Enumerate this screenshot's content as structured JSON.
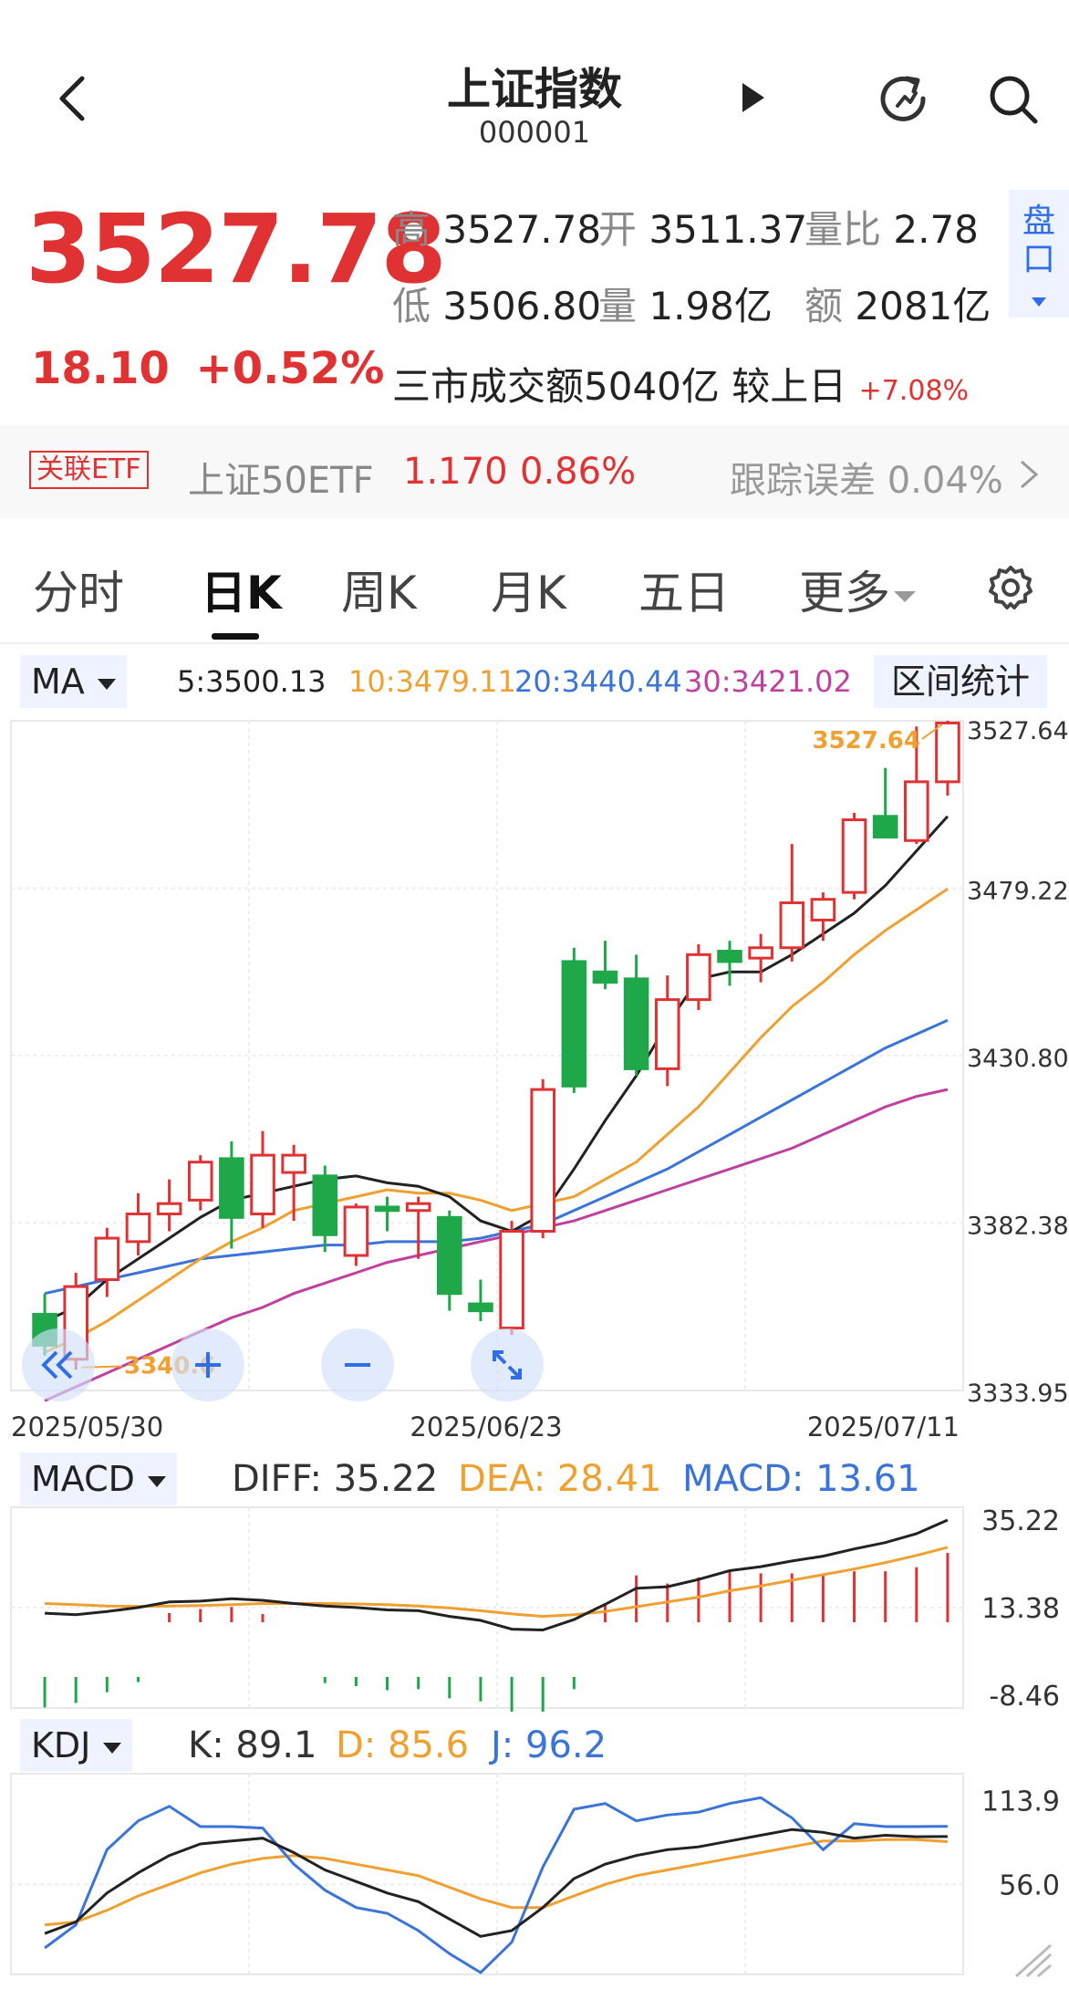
{
  "header": {
    "title": "上证指数",
    "code": "000001"
  },
  "quote": {
    "price": "3527.78",
    "change": "18.10",
    "change_pct": "+0.52%",
    "high_label": "高",
    "high": "3527.78",
    "open_label": "开",
    "open": "3511.37",
    "vol_ratio_label": "量比",
    "vol_ratio": "2.78",
    "low_label": "低",
    "low": "3506.80",
    "volume_label": "量",
    "volume": "1.98亿",
    "amount_label": "额",
    "amount": "2081亿",
    "market_turnover": "三市成交额5040亿 较上日",
    "market_turnover_chg": "+7.08%",
    "pankou_label": "盘口"
  },
  "etf": {
    "tag": "关联ETF",
    "name": "上证50ETF",
    "price": "1.170",
    "pct": "0.86%",
    "tracking": "跟踪误差 0.04%"
  },
  "tabs": [
    "分时",
    "日K",
    "周K",
    "月K",
    "五日",
    "更多"
  ],
  "ma": {
    "selector": "MA",
    "ma5": "5:3500.13",
    "ma10": "10:3479.11",
    "ma20": "20:3440.44",
    "ma30": "30:3421.02",
    "range_stats": "区间统计"
  },
  "colors": {
    "up": "#e03232",
    "down": "#1ea84a",
    "ma5": "#222222",
    "ma10": "#f0a030",
    "ma20": "#3a74d8",
    "ma30": "#c040a0",
    "accent": "#2f6ee8"
  },
  "chart_data": [
    {
      "type": "candlestick",
      "y_ticks": [
        "3527.64",
        "3479.22",
        "3430.80",
        "3382.38",
        "3333.95"
      ],
      "ylim": [
        3333.95,
        3527.64
      ],
      "x_labels": [
        "2025/05/30",
        "2025/06/23",
        "2025/07/11"
      ],
      "max_marker": "3527.64",
      "min_marker": "3340.6",
      "candles": [
        {
          "o": 3356,
          "h": 3362,
          "l": 3344,
          "c": 3347
        },
        {
          "o": 3343,
          "h": 3368,
          "l": 3340,
          "c": 3364
        },
        {
          "o": 3366,
          "h": 3381,
          "l": 3361,
          "c": 3378
        },
        {
          "o": 3377,
          "h": 3391,
          "l": 3373,
          "c": 3385
        },
        {
          "o": 3385,
          "h": 3395,
          "l": 3380,
          "c": 3388
        },
        {
          "o": 3389,
          "h": 3402,
          "l": 3386,
          "c": 3400
        },
        {
          "o": 3401,
          "h": 3406,
          "l": 3375,
          "c": 3384
        },
        {
          "o": 3385,
          "h": 3409,
          "l": 3381,
          "c": 3402
        },
        {
          "o": 3397,
          "h": 3405,
          "l": 3383,
          "c": 3402
        },
        {
          "o": 3396,
          "h": 3399,
          "l": 3374,
          "c": 3379
        },
        {
          "o": 3373,
          "h": 3388,
          "l": 3370,
          "c": 3387
        },
        {
          "o": 3387,
          "h": 3390,
          "l": 3380,
          "c": 3386
        },
        {
          "o": 3386,
          "h": 3390,
          "l": 3372,
          "c": 3388
        },
        {
          "o": 3384,
          "h": 3386,
          "l": 3357,
          "c": 3362
        },
        {
          "o": 3359,
          "h": 3366,
          "l": 3354,
          "c": 3357
        },
        {
          "o": 3352,
          "h": 3383,
          "l": 3350,
          "c": 3380
        },
        {
          "o": 3380,
          "h": 3424,
          "l": 3378,
          "c": 3421
        },
        {
          "o": 3458,
          "h": 3462,
          "l": 3420,
          "c": 3422
        },
        {
          "o": 3455,
          "h": 3464,
          "l": 3450,
          "c": 3452
        },
        {
          "o": 3453,
          "h": 3460,
          "l": 3425,
          "c": 3427
        },
        {
          "o": 3427,
          "h": 3454,
          "l": 3422,
          "c": 3447
        },
        {
          "o": 3447,
          "h": 3463,
          "l": 3444,
          "c": 3460
        },
        {
          "o": 3461,
          "h": 3464,
          "l": 3451,
          "c": 3458
        },
        {
          "o": 3459,
          "h": 3466,
          "l": 3452,
          "c": 3462
        },
        {
          "o": 3462,
          "h": 3492,
          "l": 3458,
          "c": 3475
        },
        {
          "o": 3470,
          "h": 3478,
          "l": 3464,
          "c": 3476
        },
        {
          "o": 3478,
          "h": 3501,
          "l": 3476,
          "c": 3499
        },
        {
          "o": 3500,
          "h": 3514,
          "l": 3495,
          "c": 3494
        },
        {
          "o": 3493,
          "h": 3526,
          "l": 3492,
          "c": 3510
        },
        {
          "o": 3510,
          "h": 3527.64,
          "l": 3506,
          "c": 3527
        }
      ],
      "ma5": [
        3354,
        3358,
        3366,
        3372,
        3378,
        3384,
        3389,
        3391,
        3393,
        3395,
        3396,
        3394,
        3393,
        3390,
        3383,
        3380,
        3385,
        3398,
        3412,
        3425,
        3440,
        3453,
        3455,
        3455,
        3460,
        3466,
        3472,
        3480,
        3490,
        3500
      ],
      "ma10": [
        3345,
        3349,
        3354,
        3360,
        3366,
        3372,
        3377,
        3381,
        3386,
        3388,
        3390,
        3392,
        3391,
        3391,
        3389,
        3386,
        3388,
        3390,
        3395,
        3400,
        3408,
        3416,
        3426,
        3436,
        3445,
        3452,
        3460,
        3467,
        3473,
        3479
      ],
      "ma20": [
        3362,
        3364,
        3366,
        3368,
        3370,
        3372,
        3373,
        3374,
        3375,
        3376,
        3376,
        3377,
        3377,
        3377,
        3378,
        3380,
        3382,
        3386,
        3390,
        3394,
        3398,
        3403,
        3408,
        3413,
        3418,
        3423,
        3428,
        3433,
        3437,
        3441
      ],
      "ma30": [
        3331,
        3335,
        3339,
        3343,
        3347,
        3351,
        3355,
        3358,
        3362,
        3365,
        3368,
        3371,
        3373,
        3375,
        3377,
        3379,
        3381,
        3383,
        3386,
        3389,
        3392,
        3395,
        3398,
        3401,
        3404,
        3408,
        3412,
        3416,
        3419,
        3421
      ]
    },
    {
      "type": "macd",
      "selector": "MACD",
      "diff_label": "DIFF: 35.22",
      "dea_label": "DEA: 28.41",
      "macd_label": "MACD: 13.61",
      "y_ticks": [
        "35.22",
        "13.38",
        "-8.46"
      ],
      "ylim": [
        -8.46,
        35.22
      ],
      "diff": [
        12.0,
        11.6,
        12.4,
        13.4,
        14.8,
        15.0,
        15.6,
        15.2,
        14.4,
        13.8,
        13.4,
        12.8,
        12.6,
        11.2,
        10.2,
        8.0,
        7.8,
        10.4,
        14.2,
        18.2,
        18.6,
        20.4,
        22.6,
        23.6,
        25.0,
        26.2,
        28.0,
        29.6,
        31.8,
        35.22
      ],
      "dea": [
        14.4,
        14.1,
        13.8,
        13.7,
        13.8,
        13.9,
        14.1,
        14.4,
        14.4,
        14.4,
        14.3,
        14.1,
        13.8,
        13.3,
        12.6,
        11.8,
        11.2,
        11.6,
        12.4,
        13.6,
        14.8,
        16.0,
        17.6,
        18.8,
        20.2,
        21.6,
        23.0,
        24.6,
        26.4,
        28.41
      ],
      "macd": [
        -6.0,
        -5.1,
        -3.0,
        -1.0,
        1.8,
        2.6,
        3.0,
        1.6,
        0,
        -1.2,
        -1.8,
        -2.6,
        -2.4,
        -4.2,
        -4.8,
        -7.6,
        -6.8,
        -2.4,
        3.6,
        9.2,
        7.6,
        8.8,
        10.0,
        9.6,
        9.6,
        9.2,
        10.0,
        10.0,
        10.8,
        13.61
      ]
    },
    {
      "type": "kdj",
      "selector": "KDJ",
      "k_label": "K: 89.1",
      "d_label": "D: 85.6",
      "j_label": "J: 96.2",
      "y_ticks": [
        "113.9",
        "56.0"
      ],
      "ylim": [
        0,
        120
      ],
      "k": [
        22,
        30,
        50,
        64,
        76,
        84,
        86,
        88,
        78,
        66,
        58,
        50,
        44,
        32,
        20,
        24,
        40,
        60,
        70,
        76,
        80,
        82,
        86,
        90,
        94,
        92,
        88,
        90,
        89,
        89.1
      ],
      "d": [
        28,
        30,
        38,
        48,
        56,
        64,
        70,
        74,
        76,
        74,
        70,
        66,
        62,
        54,
        46,
        40,
        40,
        48,
        56,
        62,
        66,
        70,
        74,
        78,
        82,
        86,
        86,
        87,
        87,
        85.6
      ],
      "j": [
        12,
        28,
        80,
        100,
        110,
        96,
        96,
        95,
        70,
        52,
        40,
        36,
        24,
        8,
        -6,
        16,
        68,
        108,
        112,
        100,
        104,
        106,
        112,
        116,
        102,
        80,
        98,
        96,
        96,
        96.2
      ]
    }
  ]
}
